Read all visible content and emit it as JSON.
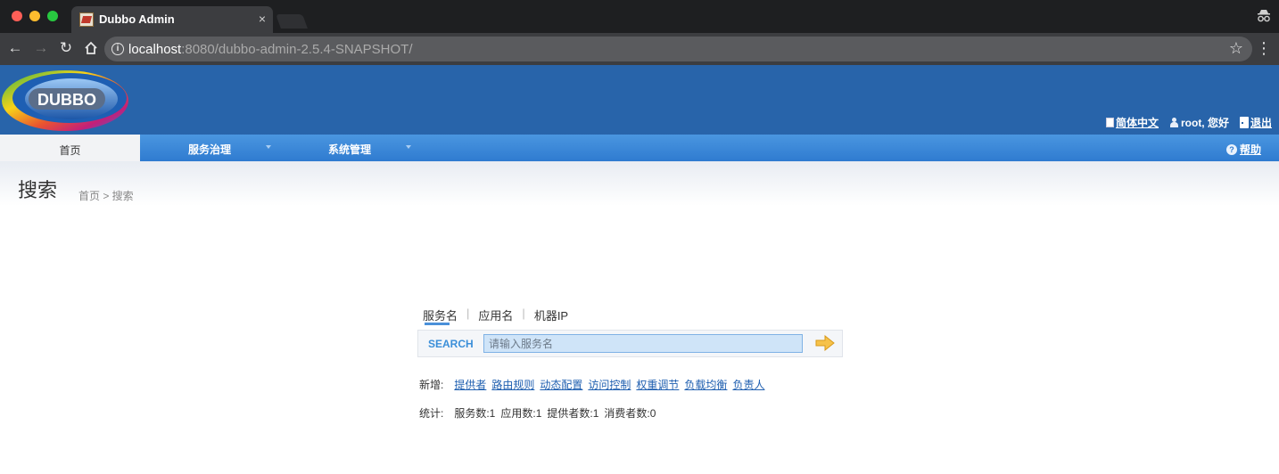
{
  "browser": {
    "tab_title": "Dubbo Admin",
    "tab_close": "×",
    "url_host": "localhost",
    "url_rest": ":8080/dubbo-admin-2.5.4-SNAPSHOT/"
  },
  "header": {
    "logo_text": "DUBBO",
    "language_label": "简体中文",
    "user_greeting": "root, 您好",
    "logout_label": "退出"
  },
  "nav": {
    "items": [
      {
        "label": "首页"
      },
      {
        "label": "服务治理"
      },
      {
        "label": "系统管理"
      }
    ],
    "help_label": "帮助"
  },
  "page": {
    "title": "搜索",
    "breadcrumb": "首页 > 搜索"
  },
  "search": {
    "tabs": [
      {
        "label": "服务名"
      },
      {
        "label": "应用名"
      },
      {
        "label": "机器IP"
      }
    ],
    "separator": "|",
    "label": "SEARCH",
    "placeholder": "请输入服务名"
  },
  "add": {
    "label": "新增:",
    "links": [
      {
        "label": "提供者"
      },
      {
        "label": "路由规则"
      },
      {
        "label": "动态配置"
      },
      {
        "label": "访问控制"
      },
      {
        "label": "权重调节"
      },
      {
        "label": "负载均衡"
      },
      {
        "label": "负责人"
      }
    ]
  },
  "stats": {
    "label": "统计:",
    "items": [
      {
        "text": "服务数:1"
      },
      {
        "text": "应用数:1"
      },
      {
        "text": "提供者数:1"
      },
      {
        "text": "消费者数:0"
      }
    ]
  },
  "colors": {
    "header_bg": "#2864aa",
    "nav_bg": "#3a88d8",
    "link": "#1f5fb0",
    "search_label": "#3b8fd9"
  },
  "icons": {
    "back": "back-arrow-icon",
    "forward": "forward-arrow-icon",
    "reload": "reload-icon",
    "home": "home-icon",
    "star": "bookmark-star-icon",
    "help": "help-icon"
  }
}
